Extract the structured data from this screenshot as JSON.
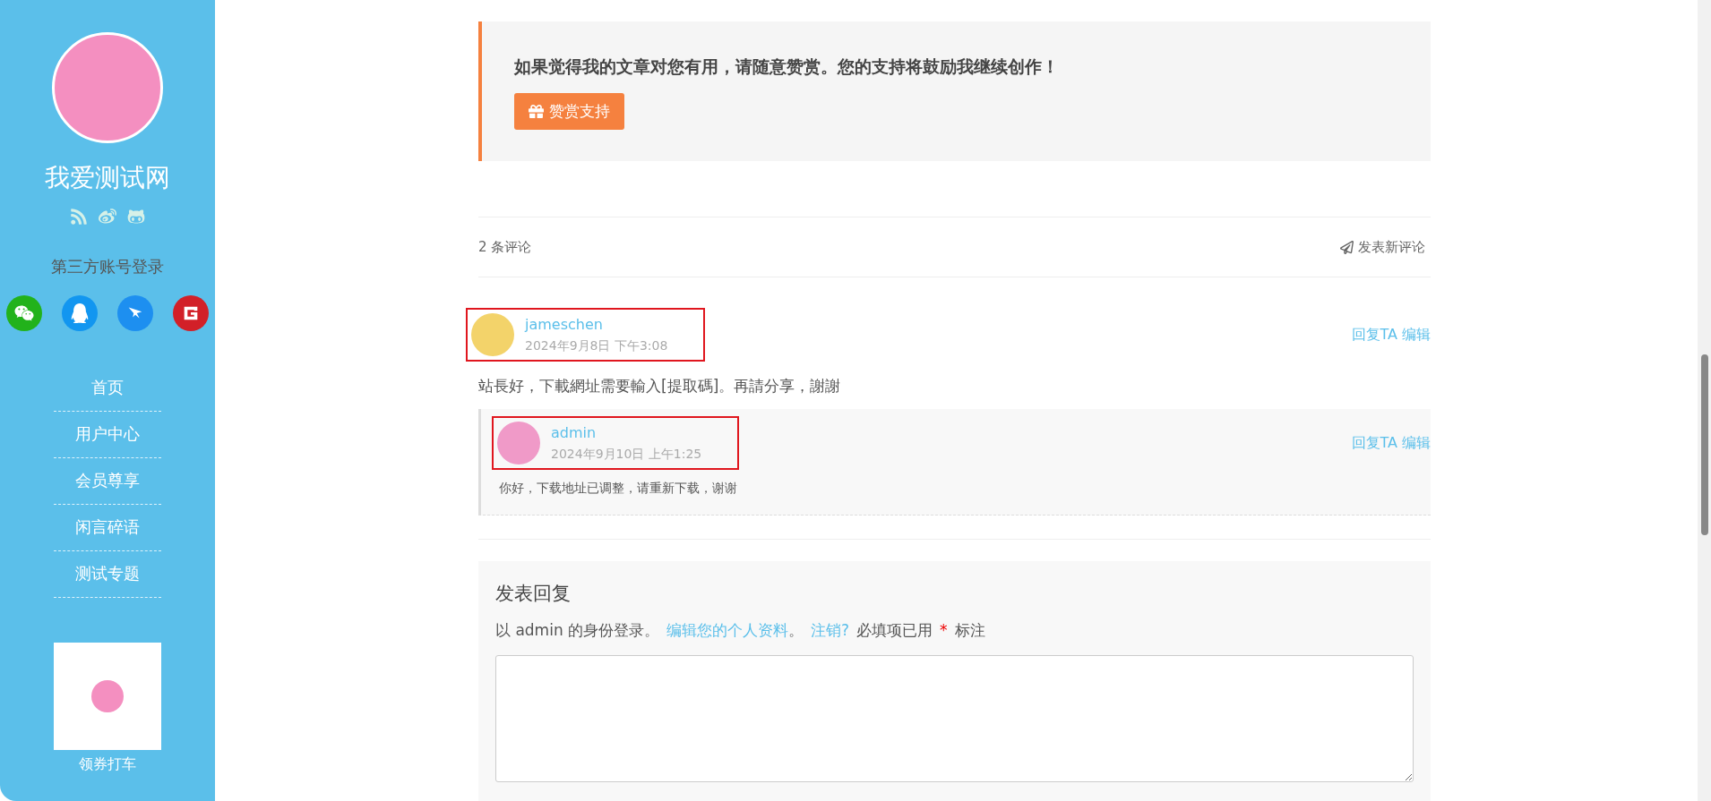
{
  "sidebar": {
    "site_title": "我爱测试网",
    "login_label": "第三方账号登录",
    "nav": [
      {
        "label": "首页"
      },
      {
        "label": "用户中心"
      },
      {
        "label": "会员尊享"
      },
      {
        "label": "闲言碎语"
      },
      {
        "label": "测试专题"
      }
    ],
    "qr_caption": "领券打车"
  },
  "reward": {
    "message": "如果觉得我的文章对您有用，请随意赞赏。您的支持将鼓励我继续创作！",
    "button": "赞赏支持"
  },
  "comments_header": {
    "count": "2 条评论",
    "new_comment": "发表新评论"
  },
  "comments": [
    {
      "author": "jameschen",
      "date": "2024年9月8日 下午3:08",
      "reply": "回复TA",
      "edit": "编辑",
      "text": "站長好，下載網址需要輸入[提取碼]。再請分享，謝謝",
      "highlighted": true,
      "children": [
        {
          "author": "admin",
          "date": "2024年9月10日 上午1:25",
          "reply": "回复TA",
          "edit": "编辑",
          "text": "你好，下载地址已调整，请重新下载，谢谢",
          "highlighted": true
        }
      ]
    }
  ],
  "reply_form": {
    "title": "发表回复",
    "login_prefix": "以 admin 的身份登录。",
    "profile_link": "编辑您的个人资料",
    "separator": "。",
    "logout_link": "注销?",
    "required_note": "必填项已用",
    "required_mark": "*",
    "required_suffix": "标注"
  }
}
